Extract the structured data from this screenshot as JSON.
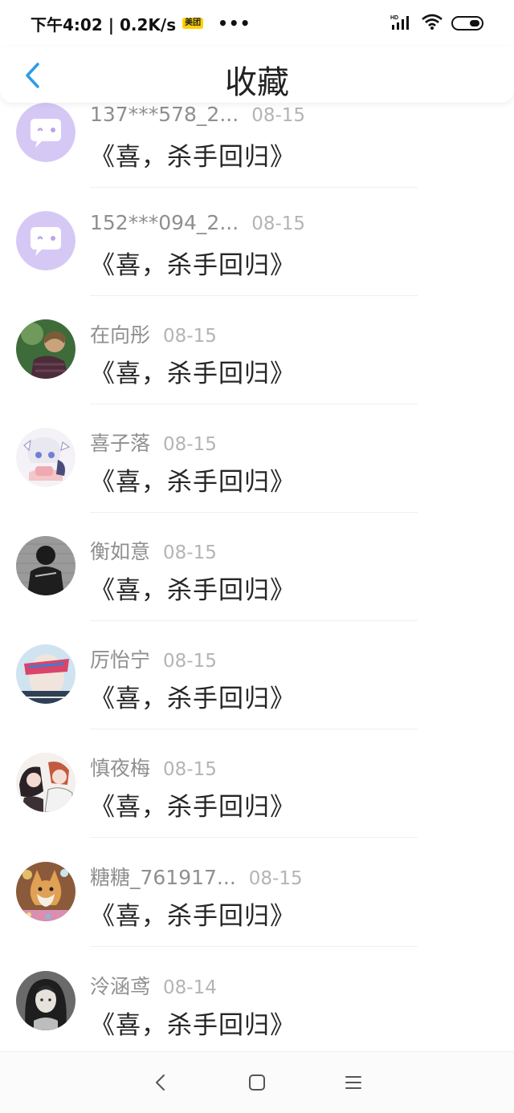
{
  "status_bar": {
    "time_speed": "下午4:02 | 0.2K/s",
    "app_badge": "美团",
    "more": "•••",
    "network_label": "HD"
  },
  "header": {
    "title": "收藏"
  },
  "colors": {
    "accent": "#2e9be6",
    "bot_avatar": "#d6c8f5"
  },
  "items": [
    {
      "user": "137***578_2...",
      "date": "08-15",
      "title": "《喜，杀手回归》",
      "avatar": "bot"
    },
    {
      "user": "152***094_2...",
      "date": "08-15",
      "title": "《喜，杀手回归》",
      "avatar": "bot"
    },
    {
      "user": "在向彤",
      "date": "08-15",
      "title": "《喜，杀手回归》",
      "avatar": "photo"
    },
    {
      "user": "喜子落",
      "date": "08-15",
      "title": "《喜，杀手回归》",
      "avatar": "anime"
    },
    {
      "user": "衡如意",
      "date": "08-15",
      "title": "《喜，杀手回归》",
      "avatar": "photo"
    },
    {
      "user": "厉怡宁",
      "date": "08-15",
      "title": "《喜，杀手回归》",
      "avatar": "photo"
    },
    {
      "user": "慎夜梅",
      "date": "08-15",
      "title": "《喜，杀手回归》",
      "avatar": "anime"
    },
    {
      "user": "糖糖_761917...",
      "date": "08-15",
      "title": "《喜，杀手回归》",
      "avatar": "photo"
    },
    {
      "user": "泠涵鸢",
      "date": "08-14",
      "title": "《喜，杀手回归》",
      "avatar": "anime"
    }
  ],
  "bottom_nav": {
    "back_icon": "chevron-left",
    "home_icon": "rounded-square",
    "menu_icon": "three-lines"
  }
}
